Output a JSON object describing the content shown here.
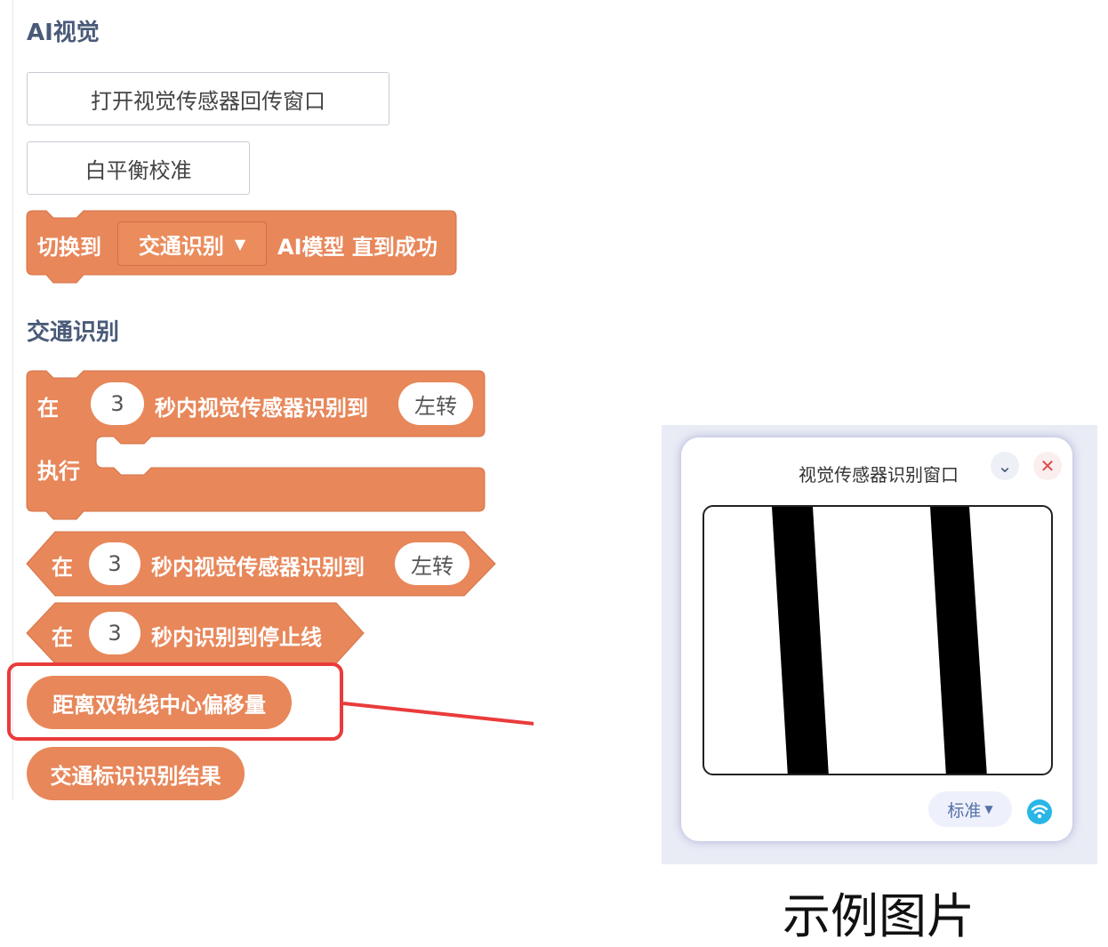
{
  "sections": {
    "ai_vision": "AI视觉",
    "traffic_recognition": "交通识别"
  },
  "buttons": {
    "open_window": "打开视觉传感器回传窗口",
    "white_balance": "白平衡校准"
  },
  "switch_block": {
    "prefix": "切换到",
    "model_value": "交通识别",
    "suffix": "AI模型 直到成功"
  },
  "if_block": {
    "label_in": "在",
    "seconds": "3",
    "text": "秒内视觉传感器识别到",
    "direction": "左转",
    "label_exec": "执行"
  },
  "bool_block_turn": {
    "label_in": "在",
    "seconds": "3",
    "text": "秒内视觉传感器识别到",
    "direction": "左转"
  },
  "bool_block_stop": {
    "label_in": "在",
    "seconds": "3",
    "text": "秒内识别到停止线"
  },
  "reporters": {
    "offset": "距离双轨线中心偏移量",
    "sign_result": "交通标识识别结果"
  },
  "sensor_window": {
    "title": "视觉传感器识别窗口",
    "mode": "标准"
  },
  "caption": "示例图片",
  "colors": {
    "block_orange": "#e8875a",
    "highlight_red": "#ea3b3b",
    "section_title": "#4a5a78"
  },
  "icons": [
    "chevron-down-icon",
    "close-icon",
    "dropdown-arrow-icon",
    "wifi-icon"
  ]
}
